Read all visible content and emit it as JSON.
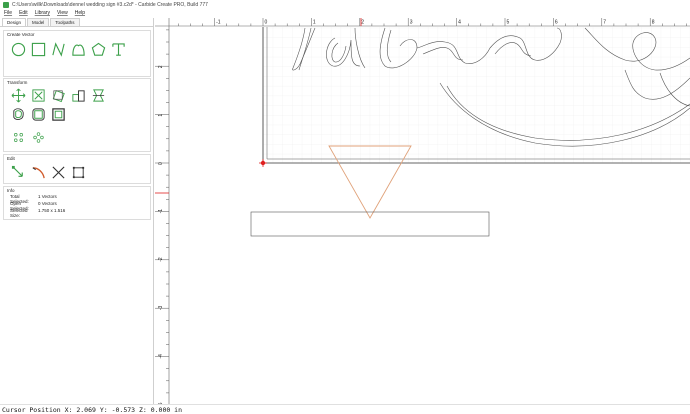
{
  "window": {
    "title": "C:\\Users\\willk\\Downloads\\dennel wedding sign #3.c2d* - Carbide Create PRO, Build 777"
  },
  "menu": [
    "File",
    "Edit",
    "Library",
    "View",
    "Help"
  ],
  "tabs": [
    "Design",
    "Model",
    "Toolpaths"
  ],
  "sections": {
    "create_vector": "Create Vector",
    "transform": "Transform",
    "edit": "Edit",
    "info": "Info"
  },
  "info": {
    "total_selected_label": "Total Selected:",
    "total_selected_value": "1 Vectors",
    "open_selected_label": "Open Selected:",
    "open_selected_value": "0 Vectors",
    "selected_size_label": "Selected Size:",
    "selected_size_value": "1.750 x 1.516"
  },
  "ruler": {
    "x_labels": [
      "-1",
      "0",
      "1",
      "2",
      "3",
      "4",
      "5",
      "6",
      "7",
      "8"
    ],
    "y_labels": [
      "2",
      "1",
      "0",
      "-1",
      "-2",
      "-3",
      "-4",
      "-5"
    ]
  },
  "status": {
    "cursor": "Cursor Position X: 2.069 Y: -0.573 Z: 0.000 in"
  },
  "colors": {
    "accent_green": "#3ca04a",
    "triangle": "#e0a27a",
    "origin_red": "#e02020",
    "grid": "#e6e6e6"
  }
}
